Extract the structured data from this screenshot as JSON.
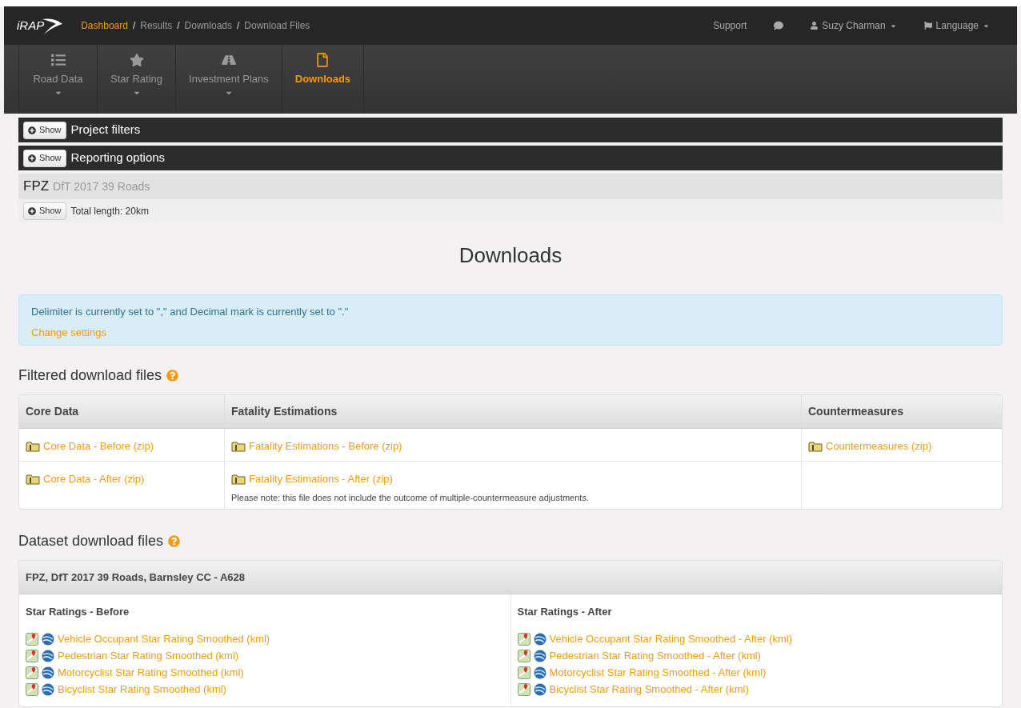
{
  "logo": "iRAP",
  "breadcrumb": [
    {
      "label": "Dashboard",
      "kind": "link"
    },
    {
      "label": "Results",
      "kind": "plain"
    },
    {
      "label": "Downloads",
      "kind": "plain"
    },
    {
      "label": "Download Files",
      "kind": "plain"
    }
  ],
  "separator": "/",
  "top_nav": {
    "support": "Support",
    "user": "Suzy Charman",
    "language": "Language"
  },
  "tabs": [
    {
      "label": "Road Data",
      "selected": false,
      "has_menu": true
    },
    {
      "label": "Star Rating",
      "selected": false,
      "has_menu": true
    },
    {
      "label": "Investment Plans",
      "selected": false,
      "has_menu": true
    },
    {
      "label": "Downloads",
      "selected": true,
      "has_menu": false
    }
  ],
  "panels": [
    {
      "button": "Show",
      "title": "Project filters"
    },
    {
      "button": "Show",
      "title": "Reporting options"
    }
  ],
  "project": {
    "code": "FPZ",
    "name": "DfT 2017 39 Roads",
    "button": "Show",
    "total": "Total length: 20km"
  },
  "heading": "Downloads",
  "alert": {
    "text": "Delimiter is currently set to \",\" and Decimal mark is currently set to \".\"",
    "link": "Change settings"
  },
  "filtered": {
    "title": "Filtered download files",
    "columns": [
      "Core Data",
      "Fatality Estimations",
      "Countermeasures"
    ],
    "rows": [
      [
        {
          "link": "Core Data - Before (zip)"
        },
        {
          "link": "Fatality Estimations - Before (zip)"
        },
        {
          "link": "Countermeasures (zip)"
        }
      ],
      [
        {
          "link": "Core Data - After (zip)"
        },
        {
          "link": "Fatality Estimations - After (zip)",
          "note": "Please note: this file does not include the outcome of multiple-countermeasure adjustments."
        },
        {}
      ]
    ]
  },
  "dataset": {
    "title": "Dataset download files",
    "header": "FPZ, DfT 2017 39 Roads, Barnsley CC - A628",
    "groups": [
      {
        "title": "Star Ratings - Before",
        "links": [
          "Vehicle Occupant Star Rating Smoothed (kml)",
          "Pedestrian Star Rating Smoothed (kml)",
          "Motorcyclist Star Rating Smoothed (kml)",
          "Bicyclist Star Rating Smoothed (kml)"
        ]
      },
      {
        "title": "Star Ratings - After",
        "links": [
          "Vehicle Occupant Star Rating Smoothed - After (kml)",
          "Pedestrian Star Rating Smoothed - After (kml)",
          "Motorcyclist Star Rating Smoothed - After (kml)",
          "Bicyclist Star Rating Smoothed - After (kml)"
        ]
      }
    ]
  }
}
